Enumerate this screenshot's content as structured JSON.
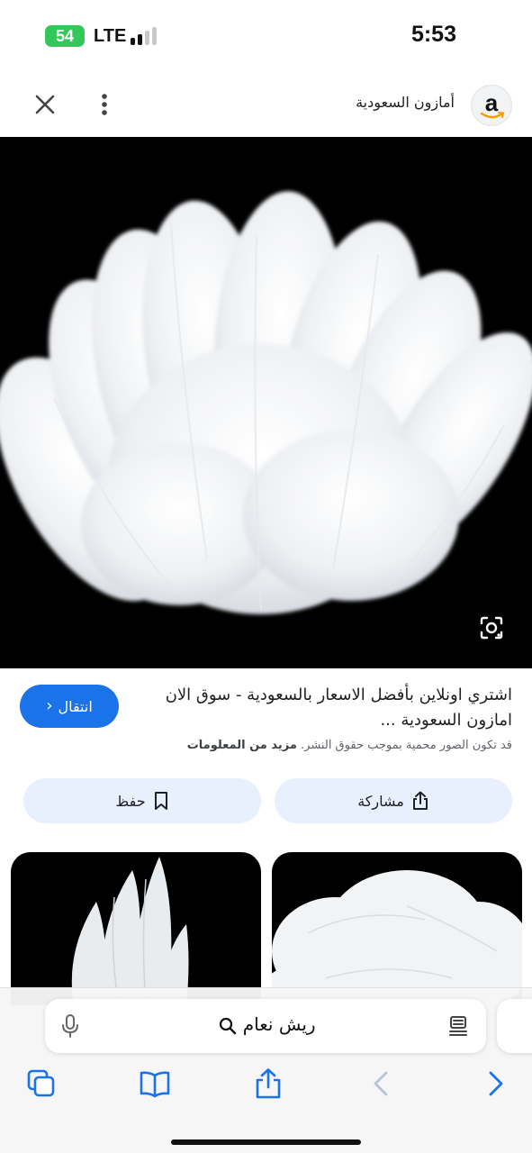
{
  "status_bar": {
    "battery": "54",
    "network": "LTE",
    "time": "5:53"
  },
  "header": {
    "site_name": "أمازون السعودية",
    "logo_letter": "a"
  },
  "result": {
    "title": "اشتري اونلاين بأفضل الاسعار بالسعودية - سوق الان امازون السعودية ...",
    "visit_label": "انتقال",
    "copyright_text": "قد تكون الصور محمية بموجب حقوق النشر.",
    "more_info_label": "مزيد من المعلومات"
  },
  "actions": {
    "share_label": "مشاركة",
    "save_label": "حفظ"
  },
  "search": {
    "query": "ريش نعام"
  },
  "colors": {
    "accent": "#1a73e8",
    "battery": "#34c759",
    "chip_bg": "#e8f0fe"
  }
}
